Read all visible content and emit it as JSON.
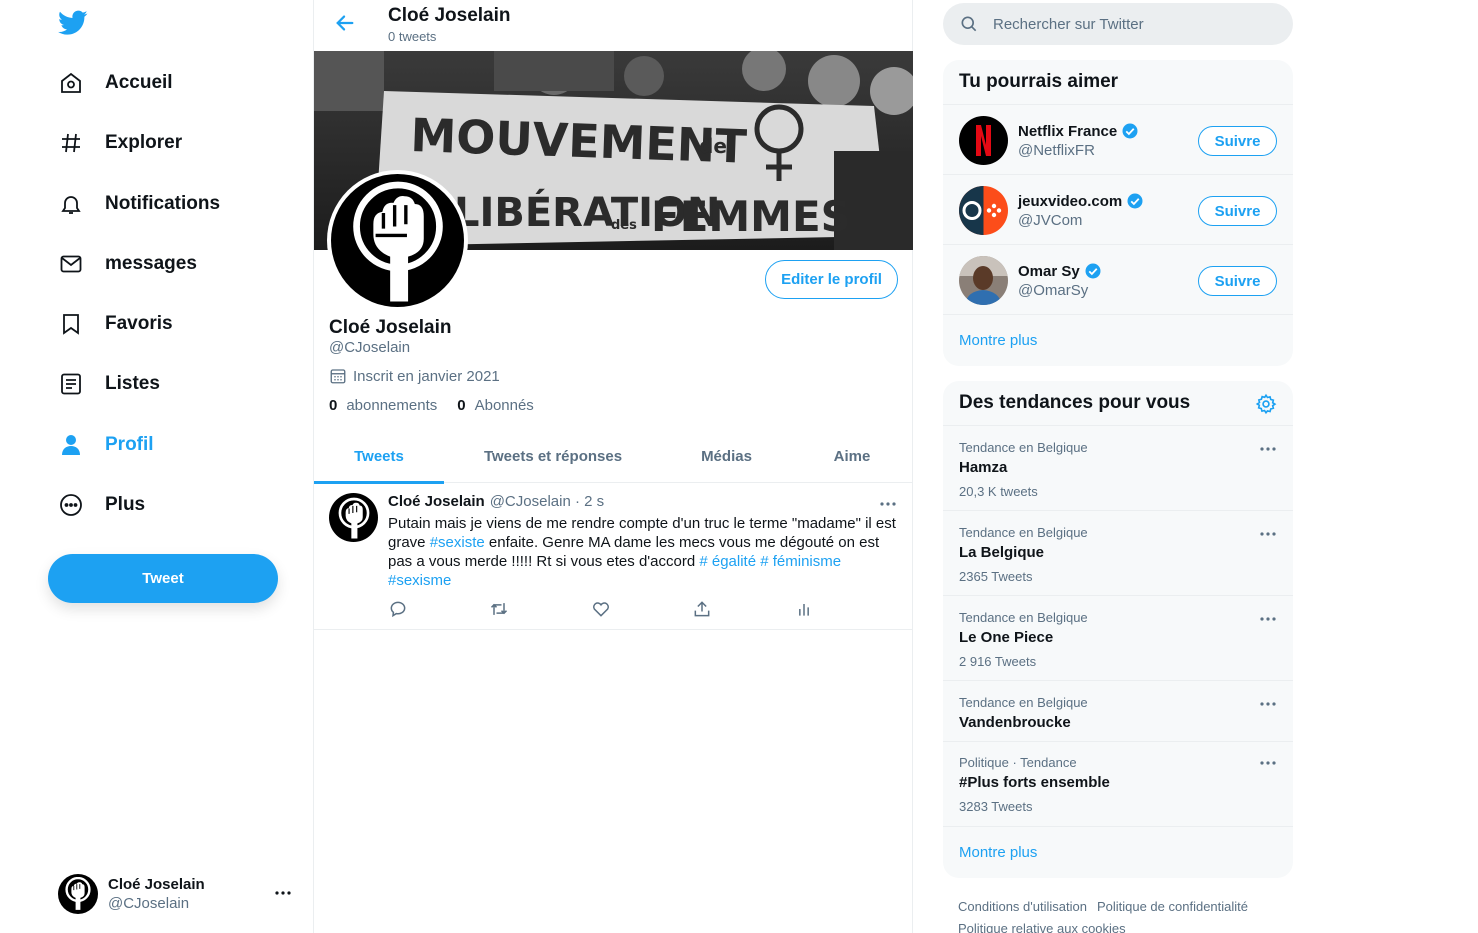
{
  "nav": {
    "items": [
      {
        "label": "Accueil"
      },
      {
        "label": "Explorer"
      },
      {
        "label": "Notifications"
      },
      {
        "label": "messages"
      },
      {
        "label": "Favoris"
      },
      {
        "label": "Listes"
      },
      {
        "label": "Profil"
      },
      {
        "label": "Plus"
      }
    ],
    "tweet_button": "Tweet",
    "account": {
      "name": "Cloé Joselain",
      "handle": "@CJoselain"
    }
  },
  "header": {
    "name": "Cloé Joselain",
    "tweet_count": "0 tweets"
  },
  "banner": {
    "text_line1": "MOUVEMENT",
    "text_de": "de",
    "text_line2": "LIBÉRATION",
    "text_des": "des",
    "text_line3": "FEMMES"
  },
  "profile": {
    "edit_button": "Editer le profil",
    "name": "Cloé Joselain",
    "handle": "@CJoselain",
    "joined": "Inscrit en janvier 2021",
    "following_count": "0",
    "following_label": "abonnements",
    "followers_count": "0",
    "followers_label": "Abonnés"
  },
  "tabs": [
    {
      "label": "Tweets"
    },
    {
      "label": "Tweets et réponses"
    },
    {
      "label": "Médias"
    },
    {
      "label": "Aime"
    }
  ],
  "tweet": {
    "name": "Cloé Joselain",
    "meta": "@CJoselain · 2 s",
    "text_before": "Putain mais je viens de me rendre compte d'un truc le terme \"madame\" il est grave ",
    "hashtag1": "#sexiste",
    "text_middle": " enfaite. Genre MA dame les mecs vous me dégouté on est pas a vous merde !!!!! Rt si vous etes d'accord ",
    "hashtag2": "# égalité",
    "hashtag3": "# féminisme",
    "hashtag4": "#sexisme"
  },
  "search": {
    "placeholder": "Rechercher sur Twitter"
  },
  "who_to_follow": {
    "title": "Tu pourrais aimer",
    "accounts": [
      {
        "name": "Netflix France",
        "handle": "@NetflixFR",
        "button": "Suivre"
      },
      {
        "name": "jeuxvideo.com",
        "handle": "@JVCom",
        "button": "Suivre"
      },
      {
        "name": "Omar Sy",
        "handle": "@OmarSy",
        "button": "Suivre"
      }
    ],
    "show_more": "Montre plus"
  },
  "trends": {
    "title": "Des tendances pour vous",
    "items": [
      {
        "context": "Tendance en Belgique",
        "name": "Hamza",
        "count": "20,3 K tweets"
      },
      {
        "context": "Tendance en Belgique",
        "name": "La Belgique",
        "count": "2365 Tweets"
      },
      {
        "context": "Tendance en Belgique",
        "name": "Le One Piece",
        "count": "2 916 Tweets"
      },
      {
        "context": "Tendance en Belgique",
        "name": "Vandenbroucke",
        "count": ""
      },
      {
        "context": "Politique · Tendance",
        "name": "#Plus forts ensemble",
        "count": "3283 Tweets"
      }
    ],
    "show_more": "Montre plus"
  },
  "footer": {
    "links": [
      "Conditions d'utilisation",
      "Politique de confidentialité",
      "Politique relative aux cookies"
    ]
  },
  "colors": {
    "accent": "#1da1f2",
    "text": "#0f1419",
    "muted": "#5b7083",
    "card_bg": "#f7f9fa"
  }
}
